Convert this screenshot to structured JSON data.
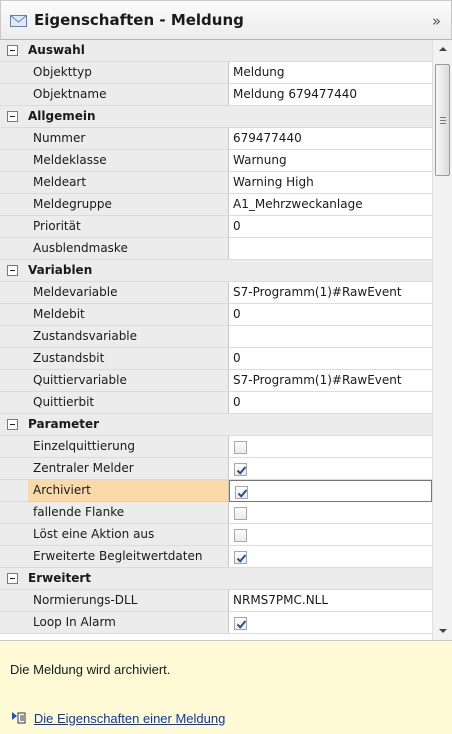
{
  "panel": {
    "title": "Eigenschaften - Meldung",
    "collapse_glyph": "»",
    "icons": {
      "title_icon": "mail-envelope-icon",
      "collapse_icon": "double-chevron-right-icon"
    },
    "colors": {
      "selected_row": "#fbd9a8",
      "description_bg": "#fdfad5",
      "link": "#0b38b8"
    }
  },
  "categories": {
    "auswahl": {
      "label": "Auswahl",
      "rows": [
        {
          "name": "Objekttyp",
          "value": "Meldung"
        },
        {
          "name": "Objektname",
          "value": "Meldung 679477440"
        }
      ]
    },
    "allgemein": {
      "label": "Allgemein",
      "rows": [
        {
          "name": "Nummer",
          "value": "679477440"
        },
        {
          "name": "Meldeklasse",
          "value": "Warnung"
        },
        {
          "name": "Meldeart",
          "value": "Warning High"
        },
        {
          "name": "Meldegruppe",
          "value": "A1_Mehrzweckanlage"
        },
        {
          "name": "Priorität",
          "value": "0"
        },
        {
          "name": "Ausblendmaske",
          "value": ""
        }
      ]
    },
    "variablen": {
      "label": "Variablen",
      "rows": [
        {
          "name": "Meldevariable",
          "value": "S7-Programm(1)#RawEvent"
        },
        {
          "name": "Meldebit",
          "value": "0"
        },
        {
          "name": "Zustandsvariable",
          "value": ""
        },
        {
          "name": "Zustandsbit",
          "value": "0"
        },
        {
          "name": "Quittiervariable",
          "value": "S7-Programm(1)#RawEvent"
        },
        {
          "name": "Quittierbit",
          "value": "0"
        }
      ]
    },
    "parameter": {
      "label": "Parameter",
      "rows": [
        {
          "name": "Einzelquittierung",
          "checked": false
        },
        {
          "name": "Zentraler Melder",
          "checked": true
        },
        {
          "name": "Archiviert",
          "checked": true,
          "selected": true
        },
        {
          "name": "fallende Flanke",
          "checked": false
        },
        {
          "name": "Löst eine Aktion aus",
          "checked": false
        },
        {
          "name": "Erweiterte Begleitwertdaten",
          "checked": true
        }
      ]
    },
    "erweitert": {
      "label": "Erweitert",
      "rows": [
        {
          "name": "Normierungs-DLL",
          "value": "NRMS7PMC.NLL"
        },
        {
          "name": "Loop In Alarm",
          "checked": true
        }
      ]
    }
  },
  "description": {
    "text": "Die Meldung wird archiviert.",
    "link_text": "Die Eigenschaften einer Meldung",
    "link_icon": "help-topic-arrow-icon"
  }
}
